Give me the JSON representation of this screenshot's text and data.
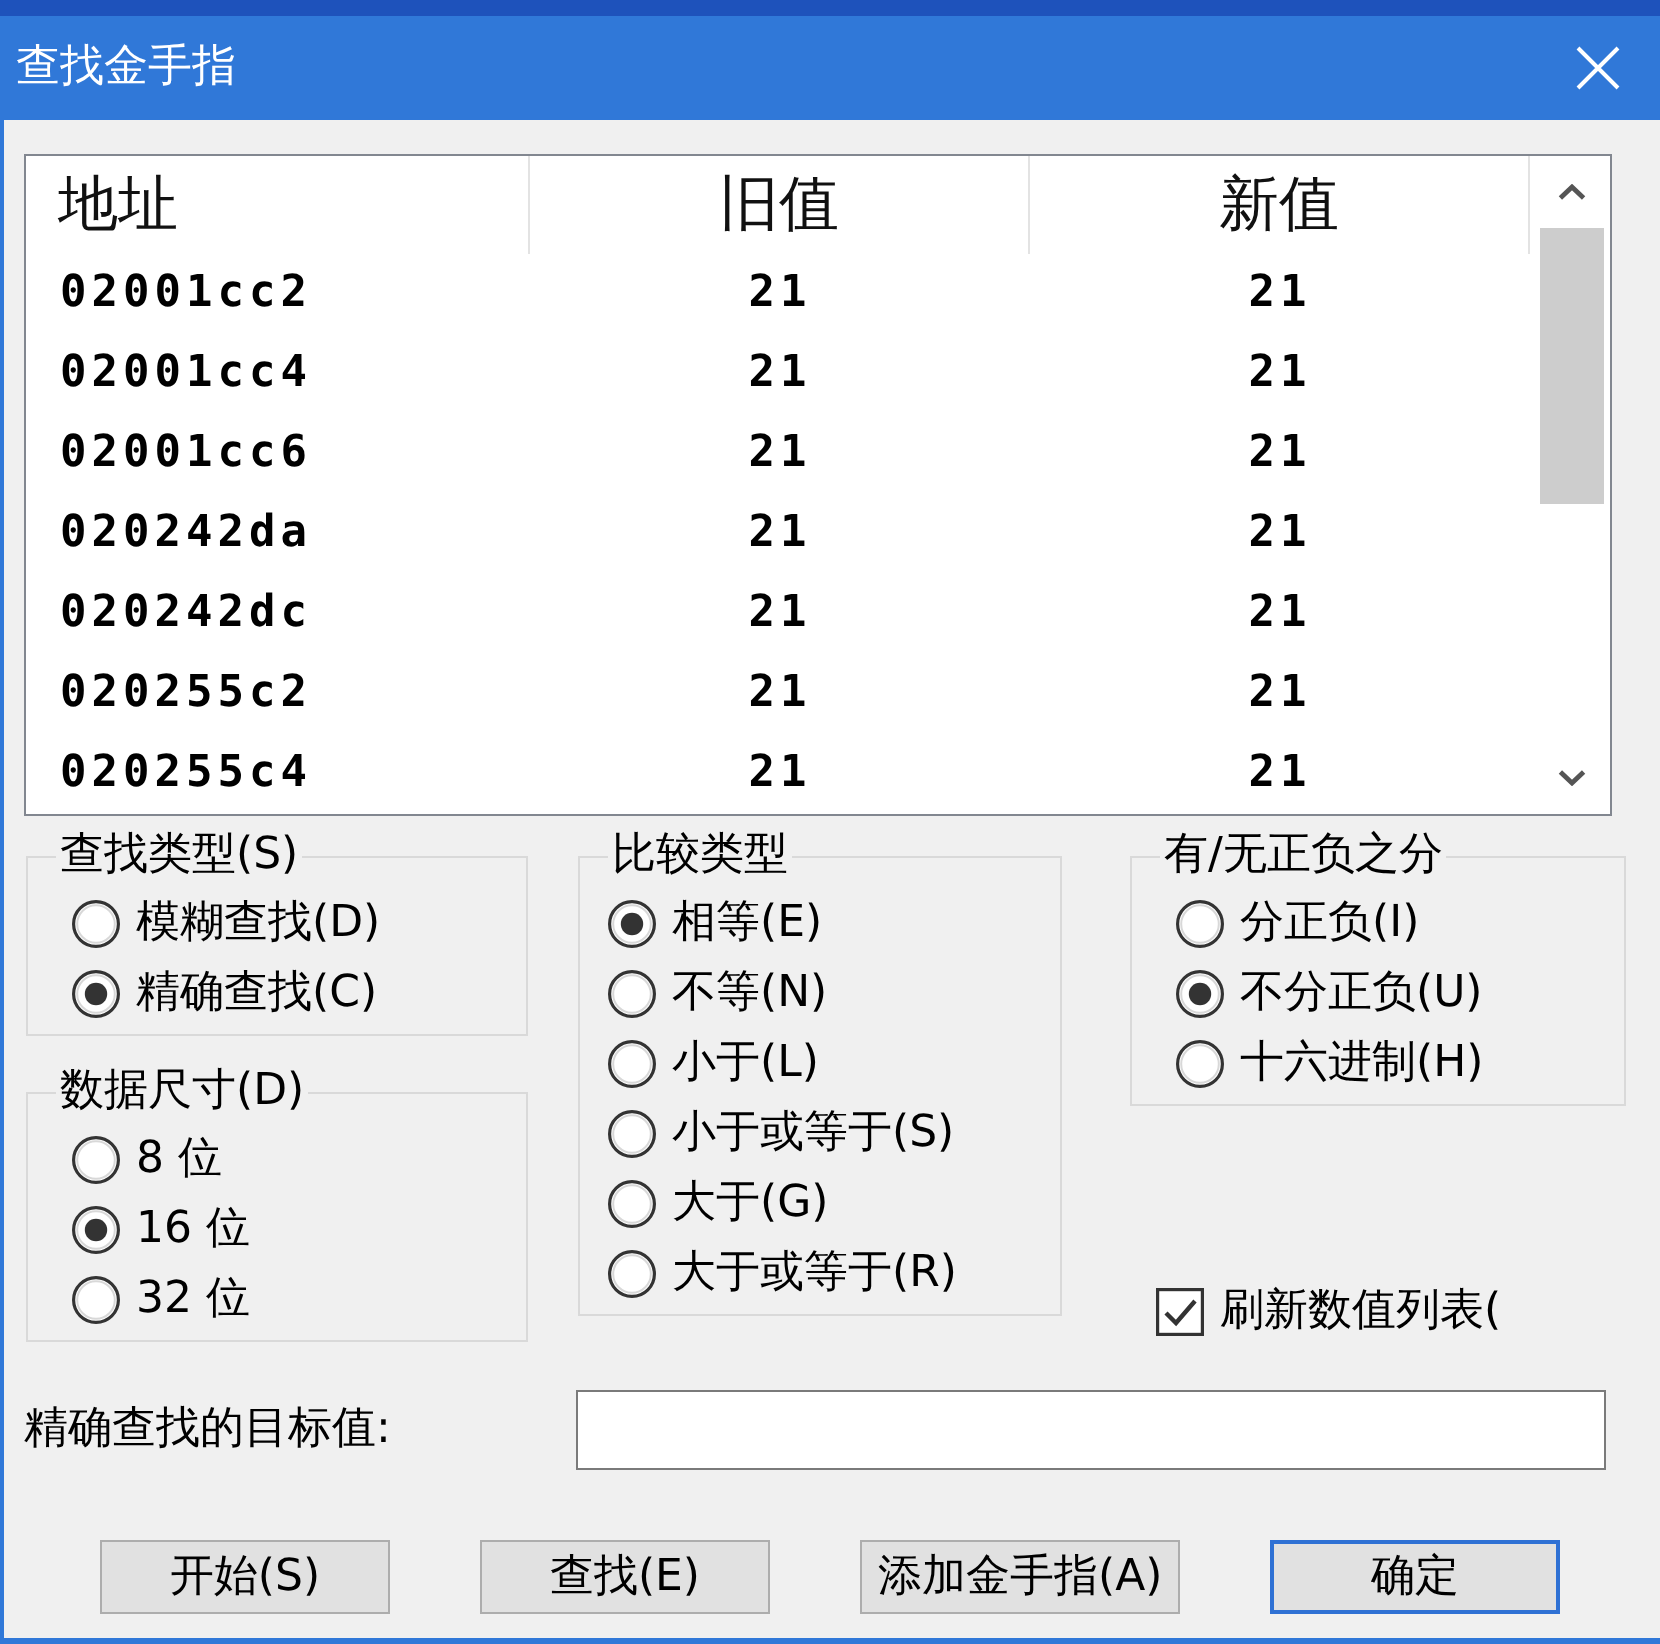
{
  "window": {
    "title": "查找金手指"
  },
  "table": {
    "columns": [
      "地址",
      "旧值",
      "新值"
    ],
    "rows": [
      [
        "02001cc2",
        "21",
        "21"
      ],
      [
        "02001cc4",
        "21",
        "21"
      ],
      [
        "02001cc6",
        "21",
        "21"
      ],
      [
        "020242da",
        "21",
        "21"
      ],
      [
        "020242dc",
        "21",
        "21"
      ],
      [
        "020255c2",
        "21",
        "21"
      ],
      [
        "020255c4",
        "21",
        "21"
      ]
    ]
  },
  "option_columns": [
    {
      "groups": [
        {
          "title": "查找类型(S)",
          "options": [
            {
              "label": "模糊查找(D)",
              "selected": false
            },
            {
              "label": "精确查找(C)",
              "selected": true
            }
          ]
        },
        {
          "title": "数据尺寸(D)",
          "options": [
            {
              "label": "8 位",
              "selected": false
            },
            {
              "label": "16 位",
              "selected": true
            },
            {
              "label": "32 位",
              "selected": false
            }
          ]
        }
      ]
    },
    {
      "groups": [
        {
          "title": "比较类型",
          "options": [
            {
              "label": "相等(E)",
              "selected": true
            },
            {
              "label": "不等(N)",
              "selected": false
            },
            {
              "label": "小于(L)",
              "selected": false
            },
            {
              "label": "小于或等于(S)",
              "selected": false
            },
            {
              "label": "大于(G)",
              "selected": false
            },
            {
              "label": "大于或等于(R)",
              "selected": false
            }
          ]
        }
      ]
    },
    {
      "groups": [
        {
          "title": "有/无正负之分",
          "options": [
            {
              "label": "分正负(I)",
              "selected": false
            },
            {
              "label": "不分正负(U)",
              "selected": true
            },
            {
              "label": "十六进制(H)",
              "selected": false
            }
          ]
        }
      ],
      "checkbox": {
        "label": "刷新数值列表(",
        "checked": true
      }
    }
  ],
  "target_value": {
    "label": "精确查找的目标值:"
  },
  "buttons": [
    {
      "label": "开始(S)",
      "default": false
    },
    {
      "label": "查找(E)",
      "default": false
    },
    {
      "label": "添加金手指(A)",
      "default": false
    },
    {
      "label": "确定",
      "default": true
    }
  ]
}
